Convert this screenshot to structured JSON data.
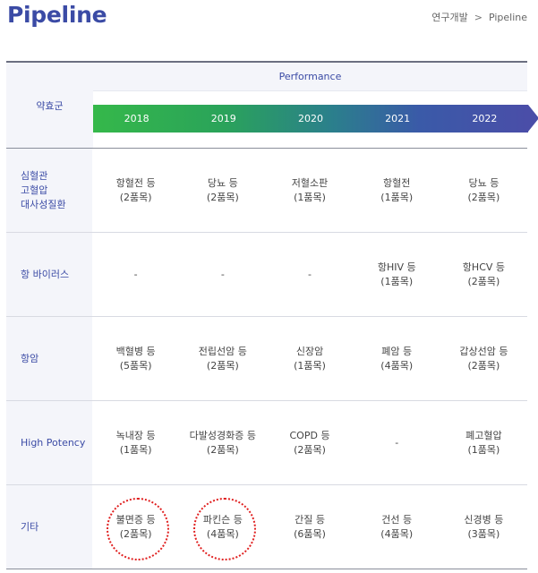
{
  "page": {
    "title": "Pipeline",
    "breadcrumb": [
      "연구개발",
      "Pipeline"
    ],
    "breadcrumb_separator": ">"
  },
  "table": {
    "category_header": "약효군",
    "performance_label": "Performance",
    "years": [
      "2018",
      "2019",
      "2020",
      "2021",
      "2022"
    ],
    "rows": [
      {
        "category": "심혈관\n고혈압\n대사성질환",
        "cells": [
          [
            "항혈전 등",
            "(2품목)"
          ],
          [
            "당뇨 등",
            "(2품목)"
          ],
          [
            "저혈소판",
            "(1품목)"
          ],
          [
            "항혈전",
            "(1품목)"
          ],
          [
            "당뇨 등",
            "(2품목)"
          ]
        ]
      },
      {
        "category": "항 바이러스",
        "cells": [
          [
            "-",
            ""
          ],
          [
            "-",
            ""
          ],
          [
            "-",
            ""
          ],
          [
            "항HIV 등",
            "(1품목)"
          ],
          [
            "항HCV 등",
            "(2품목)"
          ]
        ]
      },
      {
        "category": "항암",
        "cells": [
          [
            "백혈병 등",
            "(5품목)"
          ],
          [
            "전립선암 등",
            "(2품목)"
          ],
          [
            "신장암",
            "(1품목)"
          ],
          [
            "폐암 등",
            "(4품목)"
          ],
          [
            "갑상선암 등",
            "(2품목)"
          ]
        ]
      },
      {
        "category": "High Potency",
        "cells": [
          [
            "녹내장 등",
            "(1품목)"
          ],
          [
            "다발성경화증 등",
            "(2품목)"
          ],
          [
            "COPD 등",
            "(2품목)"
          ],
          [
            "-",
            ""
          ],
          [
            "폐고혈압",
            "(1품목)"
          ]
        ]
      },
      {
        "category": "기타",
        "cells": [
          [
            "불면증 등",
            "(2품목)"
          ],
          [
            "파킨슨 등",
            "(4품목)"
          ],
          [
            "간질 등",
            "(6품목)"
          ],
          [
            "건선 등",
            "(4품목)"
          ],
          [
            "신경병 등",
            "(3품목)"
          ]
        ]
      }
    ]
  },
  "annotations": {
    "circle_color": "#e02020"
  },
  "colors": {
    "brand": "#3b4ba5",
    "gradient_start": "#35b84a",
    "gradient_end": "#4a4ea8"
  }
}
